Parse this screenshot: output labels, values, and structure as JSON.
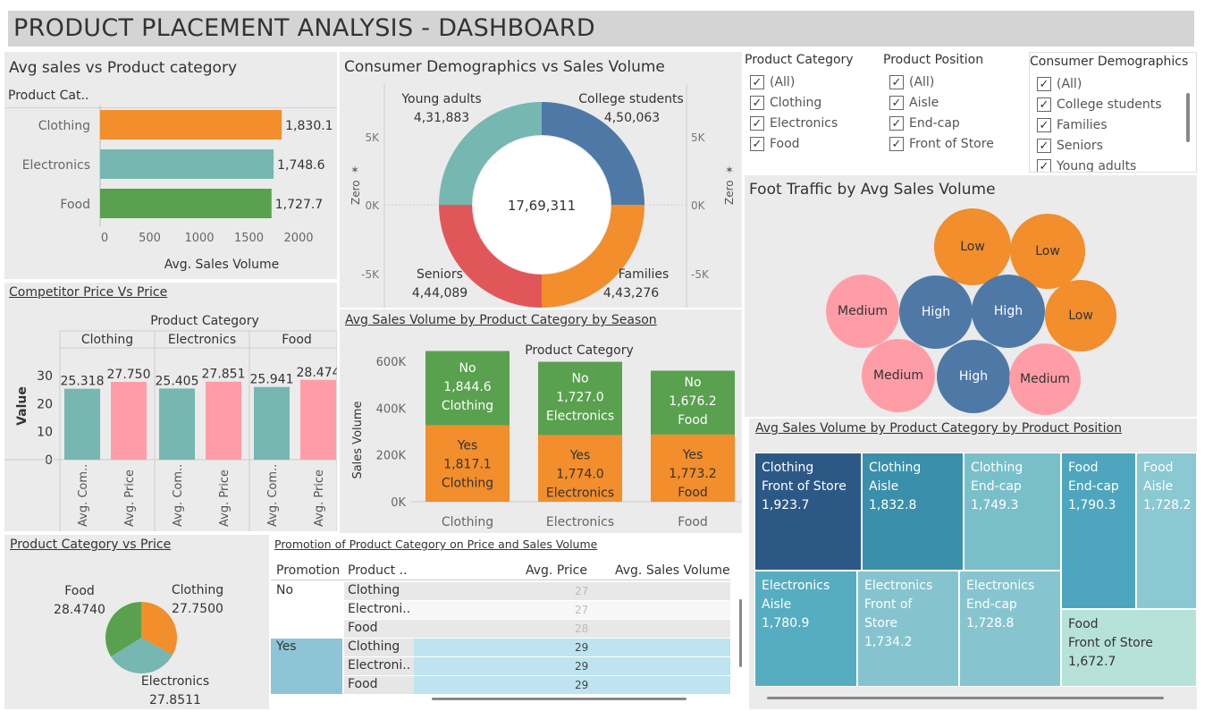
{
  "title": "PRODUCT PLACEMENT ANALYSIS - DASHBOARD",
  "avg_sales_category": {
    "title": "Avg sales vs Product category",
    "col_header": "Product Cat..",
    "xlabel": "Avg. Sales Volume",
    "ticks": [
      "0",
      "500",
      "1000",
      "1500",
      "2000"
    ],
    "bars": [
      {
        "label": "Clothing",
        "value": "1,830.1",
        "num": 1830.1,
        "color": "#f28e2b"
      },
      {
        "label": "Electronics",
        "value": "1,748.6",
        "num": 1748.6,
        "color": "#76b7b2"
      },
      {
        "label": "Food",
        "value": "1,727.7",
        "num": 1727.7,
        "color": "#59a14f"
      }
    ]
  },
  "demographics": {
    "title": "Consumer Demographics vs  Sales Volume",
    "total": "17,69,311",
    "axis_left": [
      "5K",
      "0K",
      "-5K"
    ],
    "axis_right": [
      "5K",
      "0K",
      "-5K"
    ],
    "zero_label": "Zero",
    "segments": [
      {
        "name": "Young adults",
        "value": "4,31,883",
        "color": "#76b7b2"
      },
      {
        "name": "College students",
        "value": "4,50,063",
        "color": "#4e79a7"
      },
      {
        "name": "Families",
        "value": "4,43,276",
        "color": "#f28e2b"
      },
      {
        "name": "Seniors",
        "value": "4,44,089",
        "color": "#e15759"
      }
    ]
  },
  "filters": {
    "product_category": {
      "title": "Product Category",
      "items": [
        "(All)",
        "Clothing",
        "Electronics",
        "Food"
      ]
    },
    "product_position": {
      "title": "Product Position",
      "items": [
        "(All)",
        "Aisle",
        "End-cap",
        "Front of Store"
      ]
    },
    "consumer_demographics": {
      "title": "Consumer Demographics",
      "items": [
        "(All)",
        "College students",
        "Families",
        "Seniors",
        "Young adults"
      ]
    }
  },
  "foot_traffic": {
    "title": "Foot Traffic  by Avg Sales Volume",
    "bubbles": [
      {
        "label": "Low",
        "color": "#f28e2b"
      },
      {
        "label": "Low",
        "color": "#f28e2b"
      },
      {
        "label": "Medium",
        "color": "#ff9da7"
      },
      {
        "label": "High",
        "color": "#4e79a7"
      },
      {
        "label": "High",
        "color": "#4e79a7"
      },
      {
        "label": "Low",
        "color": "#f28e2b"
      },
      {
        "label": "Medium",
        "color": "#ff9da7"
      },
      {
        "label": "High",
        "color": "#4e79a7"
      },
      {
        "label": "Medium",
        "color": "#ff9da7"
      }
    ]
  },
  "competitor": {
    "title": "Competitor Price Vs Price",
    "header": "Product Category",
    "ylabel": "Value",
    "yticks": [
      "30",
      "20",
      "10",
      "0"
    ],
    "groups": [
      {
        "name": "Clothing",
        "comp": "25.318",
        "price": "27.750",
        "comp_v": 25.318,
        "price_v": 27.75
      },
      {
        "name": "Electronics",
        "comp": "25.405",
        "price": "27.851",
        "comp_v": 25.405,
        "price_v": 27.851
      },
      {
        "name": "Food",
        "comp": "25.941",
        "price": "28.474",
        "comp_v": 25.941,
        "price_v": 28.474
      }
    ],
    "xlabels": [
      "Avg. Com..",
      "Avg. Price"
    ]
  },
  "season": {
    "title": "Avg Sales Volume by Product Category by Season",
    "header": "Product Category",
    "ylabel": "Sales Volume",
    "yticks": [
      "600K",
      "400K",
      "200K",
      "0K"
    ],
    "categories": [
      "Clothing",
      "Electronics",
      "Food"
    ],
    "no": [
      {
        "label": "No",
        "value": "1,844.6",
        "cat": "Clothing"
      },
      {
        "label": "No",
        "value": "1,727.0",
        "cat": "Electronics"
      },
      {
        "label": "No",
        "value": "1,676.2",
        "cat": "Food"
      }
    ],
    "yes": [
      {
        "label": "Yes",
        "value": "1,817.1",
        "cat": "Clothing"
      },
      {
        "label": "Yes",
        "value": "1,774.0",
        "cat": "Electronics"
      },
      {
        "label": "Yes",
        "value": "1,773.2",
        "cat": "Food"
      }
    ]
  },
  "pie": {
    "title": "Product Category vs Price",
    "slices": [
      {
        "name": "Food",
        "value": "28.4740",
        "num": 28.474,
        "color": "#59a14f"
      },
      {
        "name": "Clothing",
        "value": "27.7500",
        "num": 27.75,
        "color": "#f28e2b"
      },
      {
        "name": "Electronics",
        "value": "27.8511",
        "num": 27.8511,
        "color": "#76b7b2"
      }
    ]
  },
  "promotion": {
    "title": "Promotion of Product Category on Price and Sales Volume",
    "headers": [
      "Promotion",
      "Product ..",
      "Avg. Price",
      "Avg. Sales Volume"
    ],
    "groups": [
      {
        "name": "No",
        "rows": [
          {
            "cat": "Clothing",
            "price": "27"
          },
          {
            "cat": "Electroni..",
            "price": "27"
          },
          {
            "cat": "Food",
            "price": "28"
          }
        ]
      },
      {
        "name": "Yes",
        "rows": [
          {
            "cat": "Clothing",
            "price": "29"
          },
          {
            "cat": "Electroni..",
            "price": "29"
          },
          {
            "cat": "Food",
            "price": "29"
          }
        ]
      }
    ]
  },
  "treemap": {
    "title": "Avg Sales Volume by Product Category by Product Position",
    "cells": [
      {
        "cat": "Clothing",
        "pos": "Front of Store",
        "value": "1,923.7",
        "color": "#2c5886"
      },
      {
        "cat": "Clothing",
        "pos": "Aisle",
        "value": "1,832.8",
        "color": "#3a8fab"
      },
      {
        "cat": "Clothing",
        "pos": "End-cap",
        "value": "1,749.3",
        "color": "#79bfca"
      },
      {
        "cat": "Food",
        "pos": "End-cap",
        "value": "1,790.3",
        "color": "#4da6bd"
      },
      {
        "cat": "Food",
        "pos": "Aisle",
        "value": "1,728.2",
        "color": "#8ac8d2"
      },
      {
        "cat": "Electronics",
        "pos": "Aisle",
        "value": "1,780.9",
        "color": "#56adc1"
      },
      {
        "cat": "Electronics",
        "pos": "Front of Store",
        "value": "1,734.2",
        "color": "#85c4cf"
      },
      {
        "cat": "Electronics",
        "pos": "End-cap",
        "value": "1,728.8",
        "color": "#86c5cf"
      },
      {
        "cat": "Food",
        "pos": "Front of Store",
        "value": "1,672.7",
        "color": "#b7e2da"
      }
    ]
  }
}
